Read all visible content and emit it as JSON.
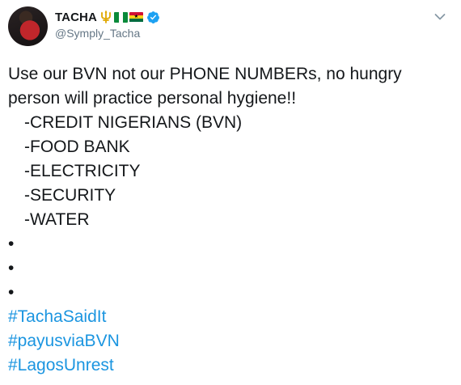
{
  "user": {
    "display_name": "TACHA",
    "handle": "@Symply_Tacha",
    "emojis": [
      "trident-emoji",
      "nigeria-flag",
      "ghana-flag"
    ],
    "verified": true,
    "verified_color": "#1da1f2"
  },
  "tweet": {
    "intro_line1": "Use our BVN not our PHONE NUMBERs, no hungry",
    "intro_line2": "person will practice personal hygiene!!",
    "list_items": [
      "-CREDIT NIGERIANS (BVN)",
      "-FOOD BANK",
      "-ELECTRICITY",
      "-SECURITY",
      "-WATER"
    ],
    "bullets": [
      "•",
      "•",
      "•"
    ],
    "hashtags": [
      "#TachaSaidIt",
      "#payusviaBVN",
      "#LagosUnrest"
    ]
  },
  "colors": {
    "text": "#14171a",
    "secondary": "#657786",
    "link": "#1b95e0"
  }
}
